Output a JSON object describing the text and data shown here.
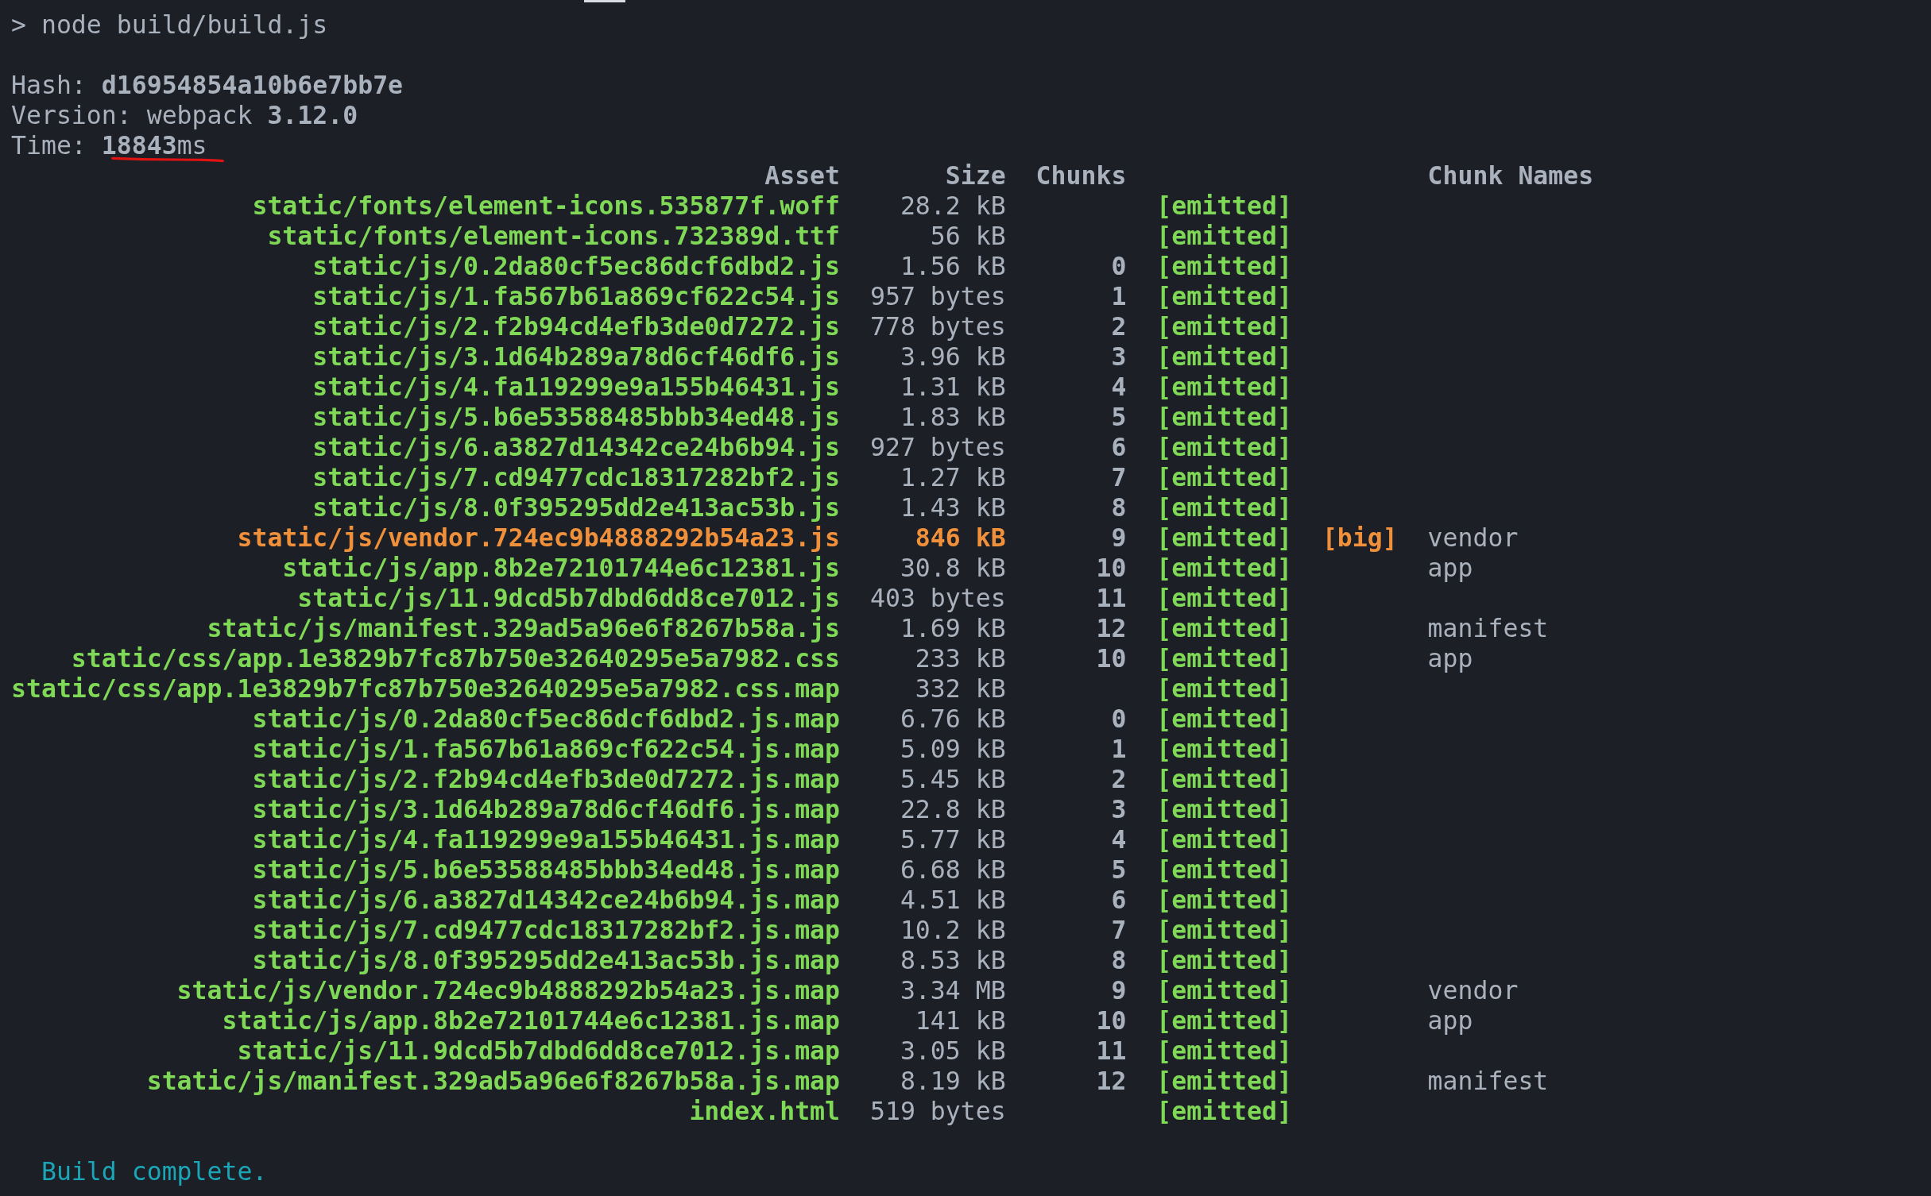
{
  "command": "> node build/build.js",
  "summary": [
    "Hash: **d16954854a10b6e7bb7e**",
    "Version: webpack **3.12.0**",
    "Time: **18843**ms"
  ],
  "table": {
    "columns": [
      "Asset",
      "Size",
      "Chunks",
      "Chunk Names"
    ],
    "rows": [
      {
        "asset": "static/fonts/element-icons.535877f.woff",
        "size": "28.2 kB",
        "status": "[emitted]",
        "big": false
      },
      {
        "asset": "static/fonts/element-icons.732389d.ttf",
        "size": "56 kB",
        "status": "[emitted]",
        "big": false
      },
      {
        "asset": "static/js/0.2da80cf5ec86dcf6dbd2.js",
        "size": "1.56 kB",
        "chunks": "0",
        "status": "[emitted]",
        "big": false
      },
      {
        "asset": "static/js/1.fa567b61a869cf622c54.js",
        "size": "957 bytes",
        "chunks": "1",
        "status": "[emitted]",
        "big": false
      },
      {
        "asset": "static/js/2.f2b94cd4efb3de0d7272.js",
        "size": "778 bytes",
        "chunks": "2",
        "status": "[emitted]",
        "big": false
      },
      {
        "asset": "static/js/3.1d64b289a78d6cf46df6.js",
        "size": "3.96 kB",
        "chunks": "3",
        "status": "[emitted]",
        "big": false
      },
      {
        "asset": "static/js/4.fa119299e9a155b46431.js",
        "size": "1.31 kB",
        "chunks": "4",
        "status": "[emitted]",
        "big": false
      },
      {
        "asset": "static/js/5.b6e53588485bbb34ed48.js",
        "size": "1.83 kB",
        "chunks": "5",
        "status": "[emitted]",
        "big": false
      },
      {
        "asset": "static/js/6.a3827d14342ce24b6b94.js",
        "size": "927 bytes",
        "chunks": "6",
        "status": "[emitted]",
        "big": false
      },
      {
        "asset": "static/js/7.cd9477cdc18317282bf2.js",
        "size": "1.27 kB",
        "chunks": "7",
        "status": "[emitted]",
        "big": false
      },
      {
        "asset": "static/js/8.0f395295dd2e413ac53b.js",
        "size": "1.43 kB",
        "chunks": "8",
        "status": "[emitted]",
        "big": false
      },
      {
        "asset": "static/js/vendor.724ec9b4888292b54a23.js",
        "size": "846 kB",
        "chunks": "9",
        "status": "[emitted]",
        "flag": "[big]",
        "chunk_names": "vendor",
        "big": true
      },
      {
        "asset": "static/js/app.8b2e72101744e6c12381.js",
        "size": "30.8 kB",
        "chunks": "10",
        "status": "[emitted]",
        "chunk_names": "app",
        "big": false
      },
      {
        "asset": "static/js/11.9dcd5b7dbd6dd8ce7012.js",
        "size": "403 bytes",
        "chunks": "11",
        "status": "[emitted]",
        "big": false
      },
      {
        "asset": "static/js/manifest.329ad5a96e6f8267b58a.js",
        "size": "1.69 kB",
        "chunks": "12",
        "status": "[emitted]",
        "chunk_names": "manifest",
        "big": false
      },
      {
        "asset": "static/css/app.1e3829b7fc87b750e32640295e5a7982.css",
        "size": "233 kB",
        "chunks": "10",
        "status": "[emitted]",
        "chunk_names": "app",
        "big": false
      },
      {
        "asset": "static/css/app.1e3829b7fc87b750e32640295e5a7982.css.map",
        "size": "332 kB",
        "status": "[emitted]",
        "big": false
      },
      {
        "asset": "static/js/0.2da80cf5ec86dcf6dbd2.js.map",
        "size": "6.76 kB",
        "chunks": "0",
        "status": "[emitted]",
        "big": false
      },
      {
        "asset": "static/js/1.fa567b61a869cf622c54.js.map",
        "size": "5.09 kB",
        "chunks": "1",
        "status": "[emitted]",
        "big": false
      },
      {
        "asset": "static/js/2.f2b94cd4efb3de0d7272.js.map",
        "size": "5.45 kB",
        "chunks": "2",
        "status": "[emitted]",
        "big": false
      },
      {
        "asset": "static/js/3.1d64b289a78d6cf46df6.js.map",
        "size": "22.8 kB",
        "chunks": "3",
        "status": "[emitted]",
        "big": false
      },
      {
        "asset": "static/js/4.fa119299e9a155b46431.js.map",
        "size": "5.77 kB",
        "chunks": "4",
        "status": "[emitted]",
        "big": false
      },
      {
        "asset": "static/js/5.b6e53588485bbb34ed48.js.map",
        "size": "6.68 kB",
        "chunks": "5",
        "status": "[emitted]",
        "big": false
      },
      {
        "asset": "static/js/6.a3827d14342ce24b6b94.js.map",
        "size": "4.51 kB",
        "chunks": "6",
        "status": "[emitted]",
        "big": false
      },
      {
        "asset": "static/js/7.cd9477cdc18317282bf2.js.map",
        "size": "10.2 kB",
        "chunks": "7",
        "status": "[emitted]",
        "big": false
      },
      {
        "asset": "static/js/8.0f395295dd2e413ac53b.js.map",
        "size": "8.53 kB",
        "chunks": "8",
        "status": "[emitted]",
        "big": false
      },
      {
        "asset": "static/js/vendor.724ec9b4888292b54a23.js.map",
        "size": "3.34 MB",
        "chunks": "9",
        "status": "[emitted]",
        "chunk_names": "vendor",
        "big": false
      },
      {
        "asset": "static/js/app.8b2e72101744e6c12381.js.map",
        "size": "141 kB",
        "chunks": "10",
        "status": "[emitted]",
        "chunk_names": "app",
        "big": false
      },
      {
        "asset": "static/js/11.9dcd5b7dbd6dd8ce7012.js.map",
        "size": "3.05 kB",
        "chunks": "11",
        "status": "[emitted]",
        "big": false
      },
      {
        "asset": "static/js/manifest.329ad5a96e6f8267b58a.js.map",
        "size": "8.19 kB",
        "chunks": "12",
        "status": "[emitted]",
        "chunk_names": "manifest",
        "big": false
      },
      {
        "asset": "index.html",
        "size": "519 bytes",
        "status": "[emitted]",
        "big": false
      }
    ]
  },
  "result": "Build complete."
}
